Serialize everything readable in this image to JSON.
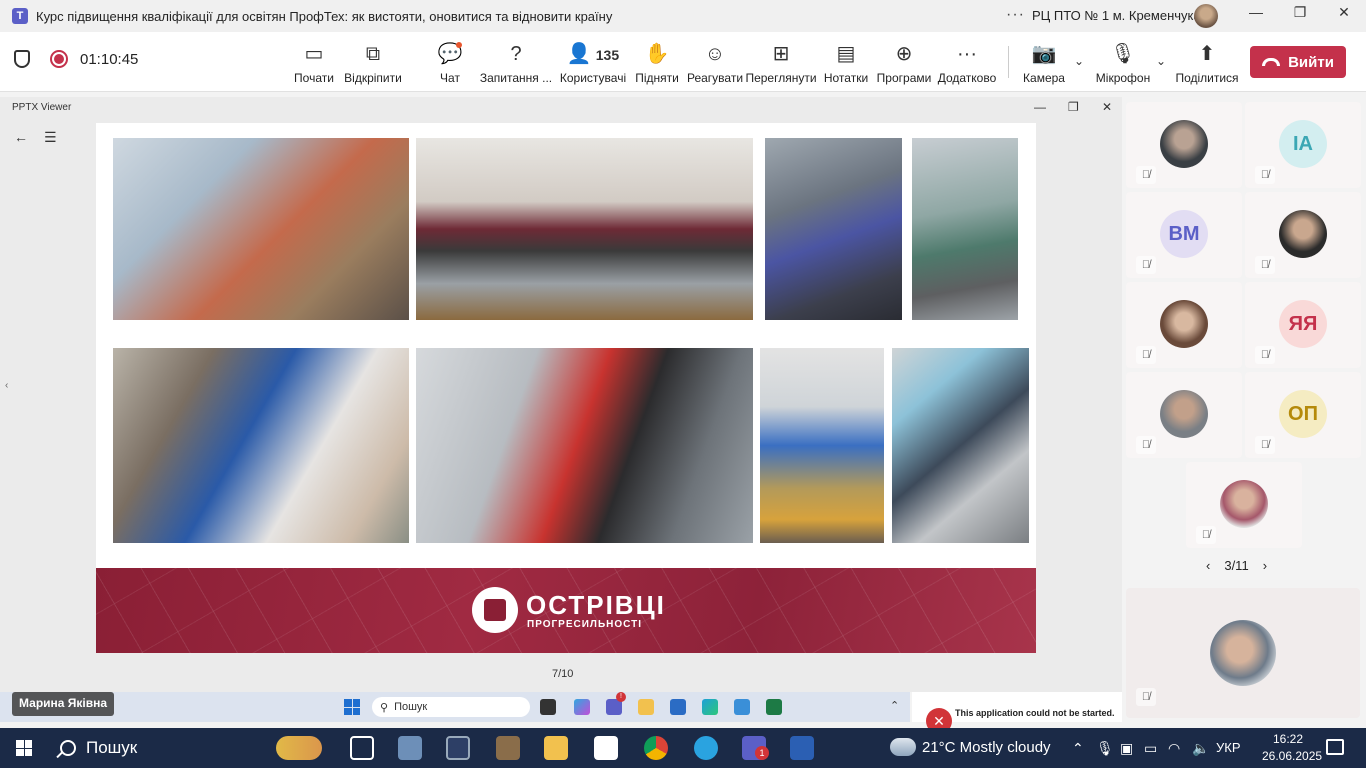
{
  "window": {
    "title": "Курс підвищення кваліфікації для освітян ПрофТех: як вистояти, оновитися та відновити країну",
    "org": "РЦ ПТО № 1 м. Кременчука",
    "more_glyph": "···"
  },
  "toolbar": {
    "timer": "01:10:45",
    "buttons": [
      {
        "label": "Почати",
        "icon": "start-screen-icon"
      },
      {
        "label": "Відкріпити",
        "icon": "unpin-icon"
      },
      {
        "label": "Чат",
        "icon": "chat-icon"
      },
      {
        "label": "Запитання ...",
        "icon": "qa-icon"
      },
      {
        "label": "Користувачі",
        "icon": "people-icon",
        "count": "135"
      },
      {
        "label": "Підняти",
        "icon": "hand-icon"
      },
      {
        "label": "Реагувати",
        "icon": "smile-icon"
      },
      {
        "label": "Переглянути",
        "icon": "grid-icon"
      },
      {
        "label": "Нотатки",
        "icon": "notes-icon"
      },
      {
        "label": "Програми",
        "icon": "plus-icon"
      },
      {
        "label": "Додатково",
        "icon": "more-icon"
      },
      {
        "label": "Камера",
        "icon": "camera-off-icon"
      },
      {
        "label": "Мікрофон",
        "icon": "mic-off-icon"
      },
      {
        "label": "Поділитися",
        "icon": "share-icon"
      }
    ],
    "leave_label": "Вийти"
  },
  "viewer": {
    "title": "PPTX Viewer",
    "page_indicator": "7/10",
    "banner_line1": "ОСТРІВЦІ",
    "banner_line2": "ПРОГРЕСИЛЬНОСТІ"
  },
  "participants": {
    "tiles": [
      {
        "type": "photo",
        "color": "#3a3f44"
      },
      {
        "type": "initials",
        "initials": "ІА",
        "bg": "#d3eef0",
        "fg": "#3ba7b4"
      },
      {
        "type": "initials",
        "initials": "ВМ",
        "bg": "#e2ddf3",
        "fg": "#5b5fc7"
      },
      {
        "type": "photo",
        "color": "#2b2b2b"
      },
      {
        "type": "photo",
        "color": "#6a4a3a"
      },
      {
        "type": "initials",
        "initials": "ЯЯ",
        "bg": "#f9d9d8",
        "fg": "#c4314b"
      },
      {
        "type": "photo",
        "color": "#7a7f85"
      },
      {
        "type": "initials",
        "initials": "ОП",
        "bg": "#f5ecc2",
        "fg": "#b58a0a"
      },
      {
        "type": "photo",
        "color": "#a5576a"
      }
    ],
    "page": "3/11",
    "self_name": "Марина Яківна"
  },
  "inner_taskbar": {
    "search_label": "Пошук",
    "error_text": "This application could not be started.",
    "badge": "!"
  },
  "taskbar": {
    "search_label": "Пошук",
    "weather": "21°C  Mostly cloudy",
    "lang": "УКР",
    "time": "16:22",
    "date": "26.06.2025",
    "teams_badge": "1"
  }
}
